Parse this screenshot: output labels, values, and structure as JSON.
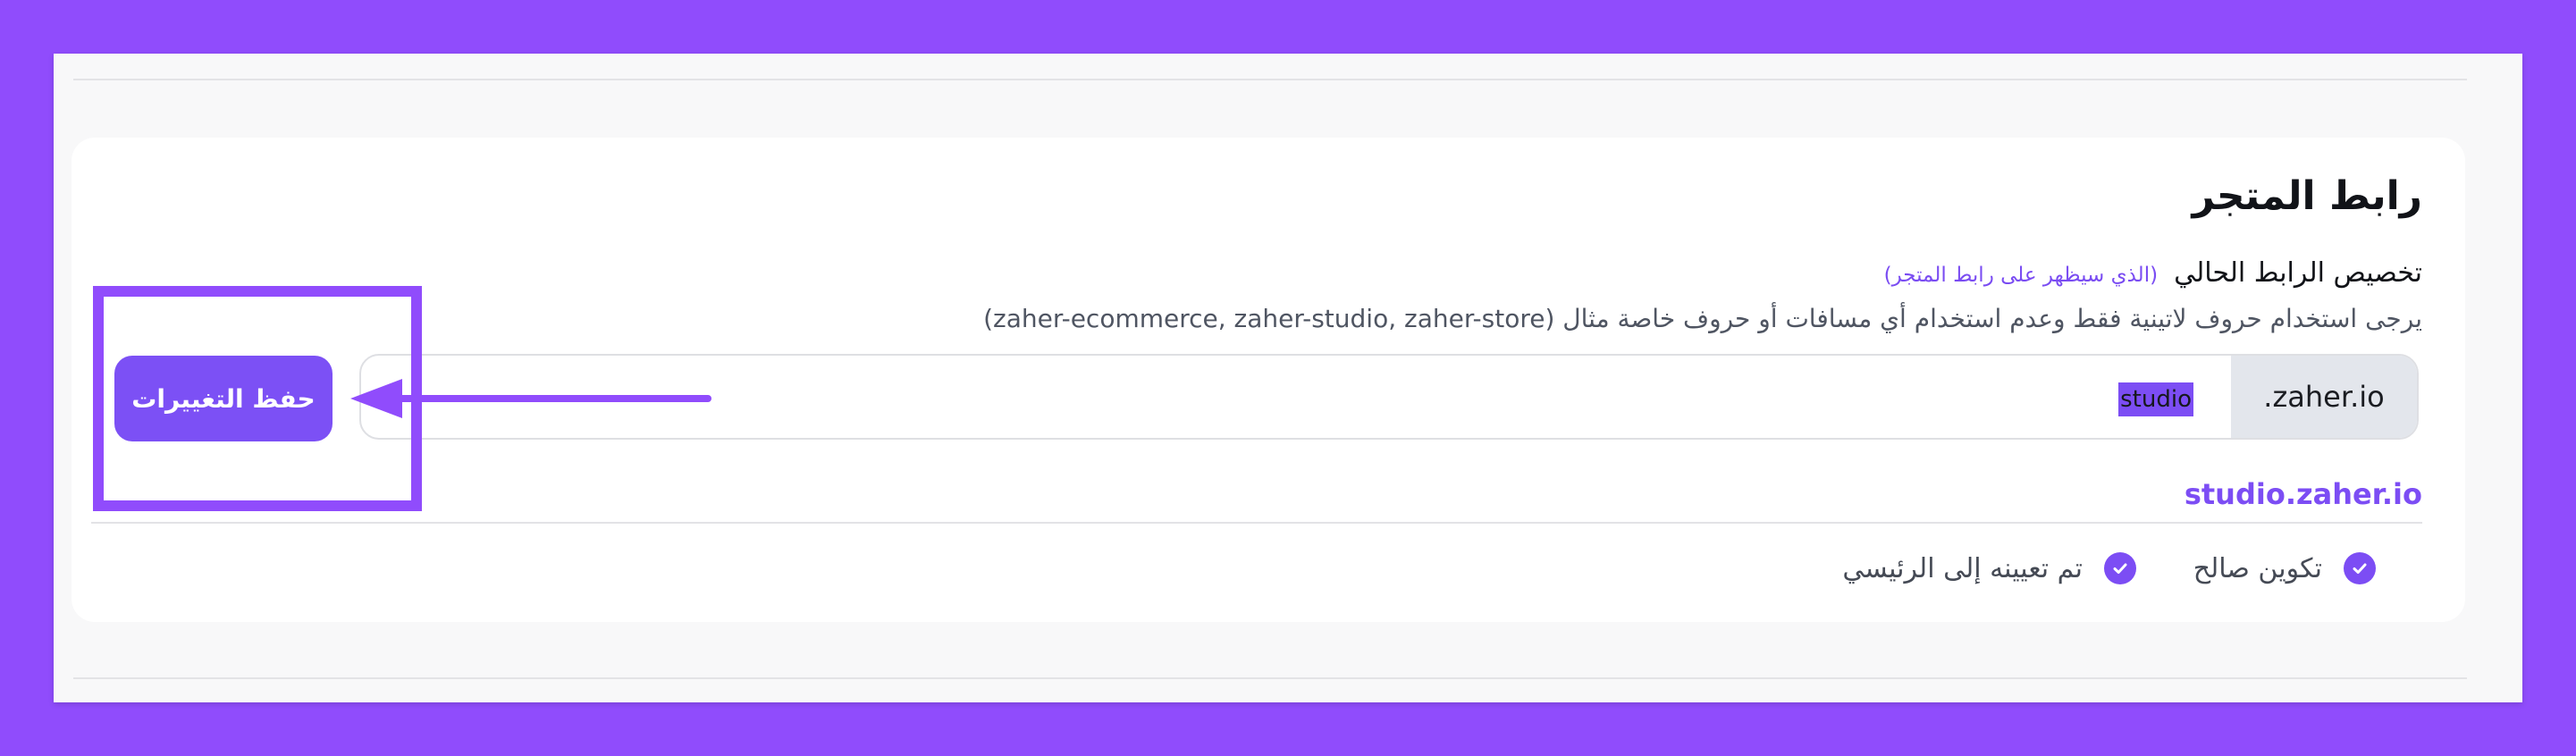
{
  "section": {
    "title": "رابط المتجر",
    "customize_label": "تخصيص الرابط الحالي",
    "customize_note": "(الذي سيظهر على رابط المتجر)",
    "help_text": "يرجى استخدام حروف لاتينية فقط وعدم استخدام أي مسافات أو حروف خاصة مثال (zaher-ecommerce, zaher-studio, zaher-store)"
  },
  "url_input": {
    "value": "studio",
    "suffix": ".zaher.io"
  },
  "save_button": {
    "label": "حفظ التغييرات"
  },
  "store_link": "studio.zaher.io",
  "statuses": [
    {
      "label": "تكوين صالح",
      "icon": "check-circle-icon"
    },
    {
      "label": "تم تعيينه إلى الرئيسي",
      "icon": "check-circle-icon"
    }
  ],
  "colors": {
    "brand": "#7c4df4",
    "frame_background": "#904cfc",
    "annotation": "#904cfc"
  }
}
